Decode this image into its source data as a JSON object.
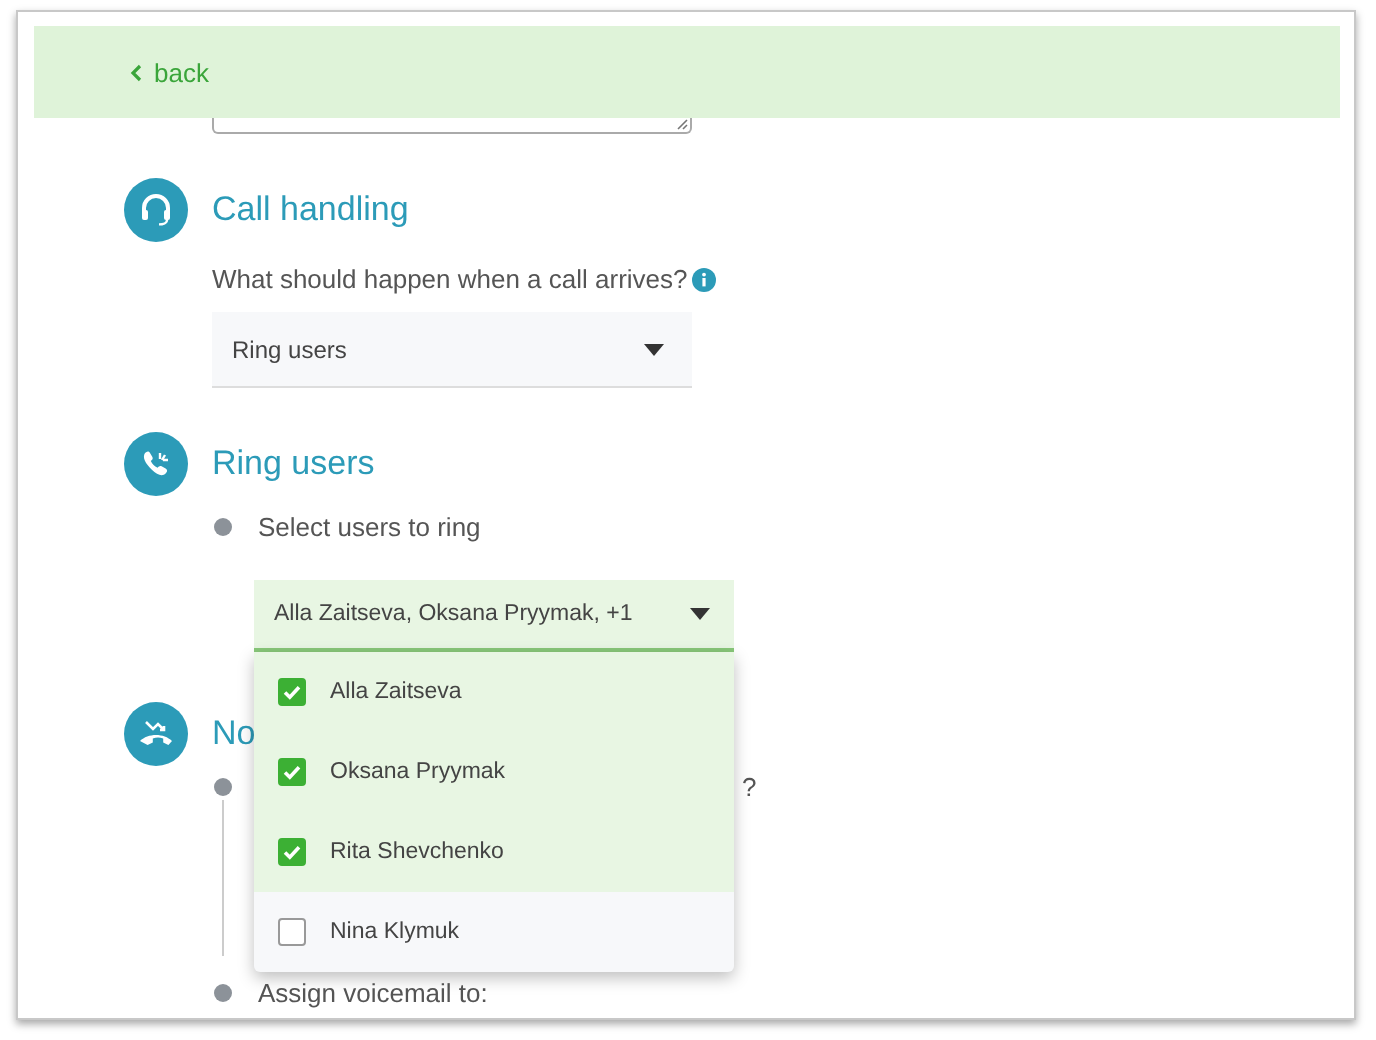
{
  "header": {
    "back_label": "back"
  },
  "call_handling": {
    "title": "Call handling",
    "question": "What should happen when a call arrives?",
    "select": {
      "value": "Ring users"
    }
  },
  "ring_users": {
    "title": "Ring users",
    "steps": [
      "Select users to ring"
    ],
    "multiselect": {
      "value": "Alla Zaitseva, Oksana Pryymak, +1",
      "expanded": true,
      "options": [
        {
          "label": "Alla Zaitseva",
          "checked": true
        },
        {
          "label": "Oksana Pryymak",
          "checked": true
        },
        {
          "label": "Rita Shevchenko",
          "checked": true
        },
        {
          "label": "Nina Klymuk",
          "checked": false
        }
      ]
    }
  },
  "no_answer": {
    "title": "No",
    "steps": [
      "?",
      "Assign voicemail to:"
    ]
  }
}
